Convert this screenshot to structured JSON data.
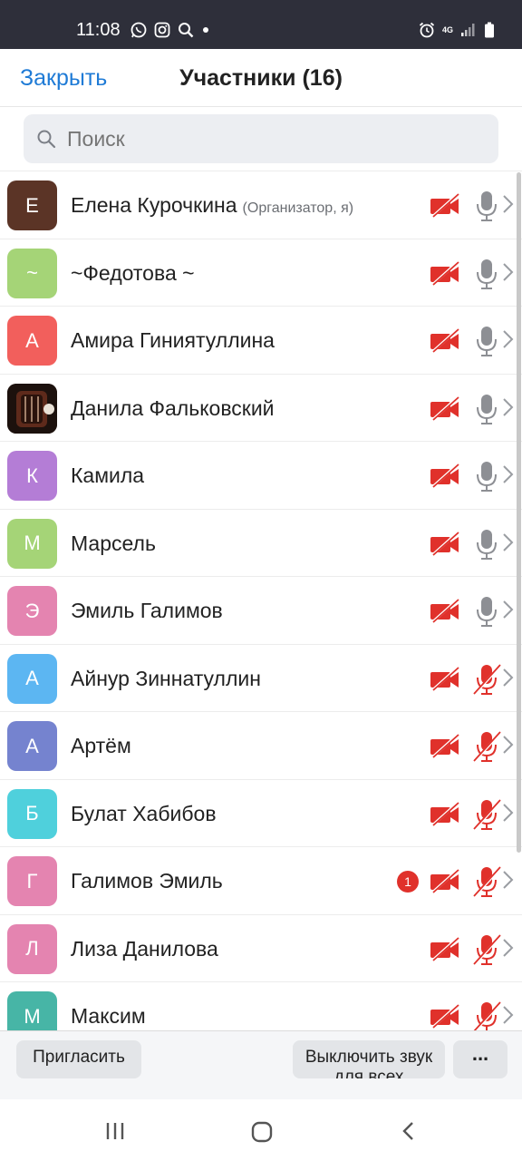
{
  "status_bar": {
    "time": "11:08",
    "network": "4G"
  },
  "header": {
    "close_label": "Закрыть",
    "title": "Участники (16)"
  },
  "search": {
    "placeholder": "Поиск"
  },
  "participants": [
    {
      "initial": "Е",
      "name": "Елена Курочкина",
      "role": "(Организатор, я)",
      "color": "#5b3426",
      "video": "off",
      "mic": "unmuted"
    },
    {
      "initial": "~",
      "name": "~Федотова ~",
      "color": "#a5d477",
      "video": "off",
      "mic": "unmuted"
    },
    {
      "initial": "А",
      "name": "Амира Гиниятуллина",
      "color": "#f25f5c",
      "video": "off",
      "mic": "unmuted"
    },
    {
      "initial": "",
      "name": "Данила Фальковский",
      "color": "#2a1a14",
      "video": "off",
      "mic": "unmuted"
    },
    {
      "initial": "К",
      "name": "Камила",
      "color": "#b47dd6",
      "video": "off",
      "mic": "unmuted"
    },
    {
      "initial": "М",
      "name": "Марсель",
      "color": "#a5d477",
      "video": "off",
      "mic": "unmuted"
    },
    {
      "initial": "Э",
      "name": "Эмиль Галимов",
      "color": "#e484b0",
      "video": "off",
      "mic": "unmuted"
    },
    {
      "initial": "А",
      "name": "Айнур Зиннатуллин",
      "color": "#5cb6f2",
      "video": "off",
      "mic": "muted"
    },
    {
      "initial": "А",
      "name": "Артём",
      "color": "#7583cf",
      "video": "off",
      "mic": "muted"
    },
    {
      "initial": "Б",
      "name": "Булат Хабибов",
      "color": "#4fd0dc",
      "video": "off",
      "mic": "muted"
    },
    {
      "initial": "Г",
      "name": "Галимов Эмиль",
      "color": "#e484b0",
      "video": "off",
      "mic": "muted",
      "badge": "1"
    },
    {
      "initial": "Л",
      "name": "Лиза Данилова",
      "color": "#e484b0",
      "video": "off",
      "mic": "muted"
    },
    {
      "initial": "М",
      "name": "Максим",
      "color": "#47b5a6",
      "video": "off",
      "mic": "muted"
    }
  ],
  "bottom_bar": {
    "invite_label": "Пригласить",
    "mute_all_label": "Выключить звук для всех",
    "more_label": "..."
  },
  "colors": {
    "accent": "#1f7bd6",
    "muted_red": "#e0312b",
    "mic_gray": "#8d8f94"
  }
}
